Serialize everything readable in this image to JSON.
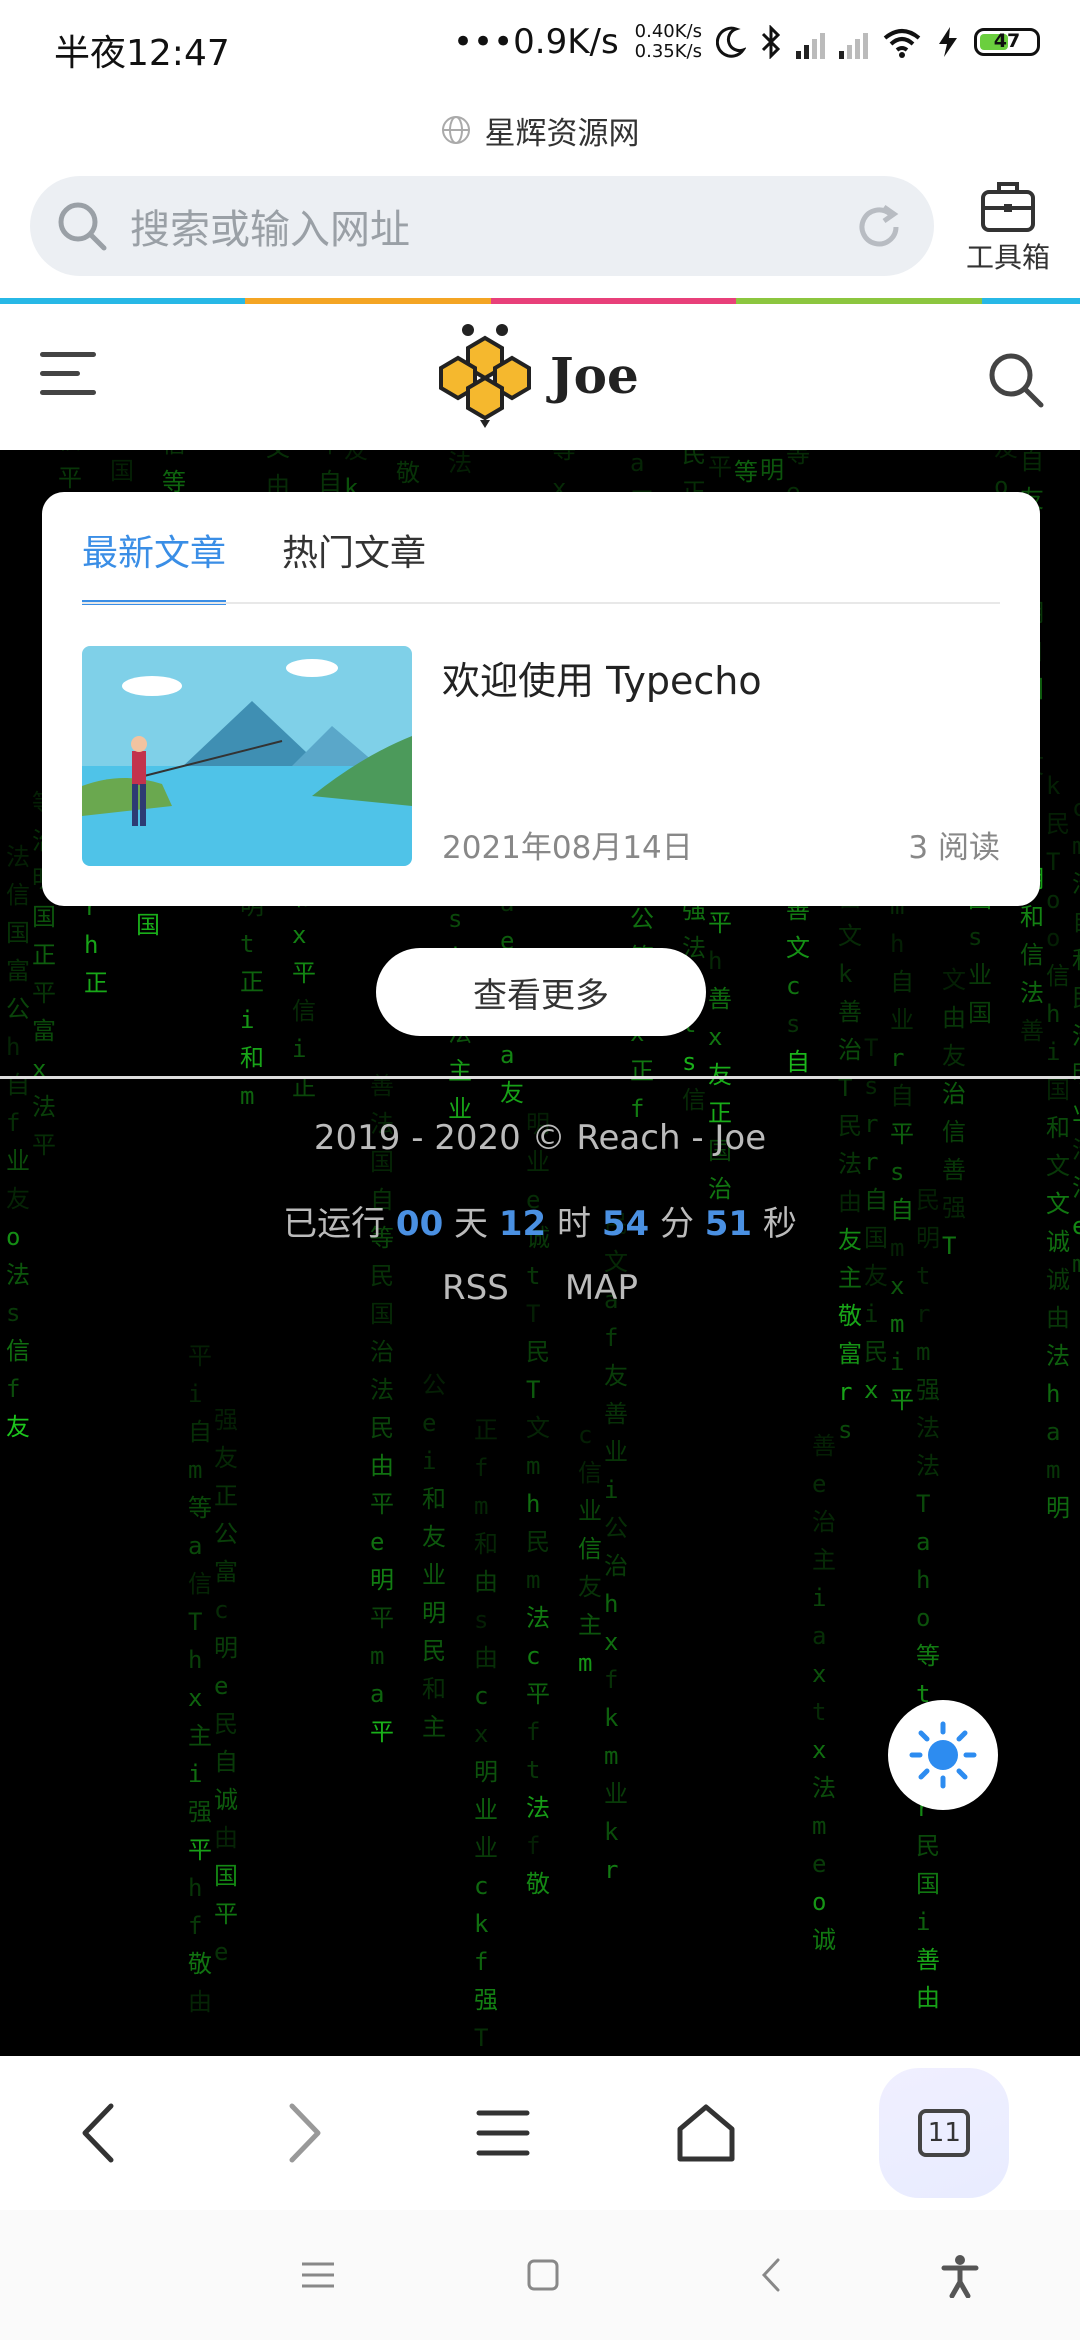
{
  "status_bar": {
    "time": "半夜12:47",
    "speed": "•••0.9K/s",
    "speed_up": "0.40K/s",
    "speed_down": "0.35K/s",
    "battery": "47"
  },
  "browser": {
    "site_name": "星辉资源网",
    "search_placeholder": "搜索或输入网址",
    "toolbox_label": "工具箱",
    "tab_count": "11"
  },
  "site": {
    "logo_text": "Joe",
    "tabs": [
      "最新文章",
      "热门文章"
    ],
    "post": {
      "title": "欢迎使用 Typecho",
      "date": "2021年08月14日",
      "reads": "3 阅读"
    },
    "more_button": "查看更多",
    "copyright": "2019 - 2020 © Reach - Joe",
    "runtime": {
      "prefix": "已运行",
      "days": "00",
      "days_unit": "天",
      "hours": "12",
      "hours_unit": "时",
      "minutes": "54",
      "minutes_unit": "分",
      "seconds": "51",
      "seconds_unit": "秒"
    },
    "links": [
      "RSS",
      "MAP"
    ]
  },
  "colors": {
    "accent": "#3a8ee6",
    "matrix_green": "#1fd21f",
    "color_line": [
      "#27b8e6",
      "#f4a524",
      "#e8407a",
      "#8cc63f",
      "#27b8e6"
    ]
  },
  "matrix_chars": [
    "善",
    "强",
    "国",
    "民",
    "法",
    "治",
    "友",
    "敬",
    "正",
    "文",
    "公",
    "由",
    "明",
    "和",
    "诚",
    "信",
    "平",
    "自",
    "主",
    "等",
    "业",
    "富",
    "a",
    "h",
    "f",
    "r",
    "t",
    "x",
    "m",
    "c",
    "k",
    "i",
    "e",
    "o",
    "s",
    "T"
  ]
}
